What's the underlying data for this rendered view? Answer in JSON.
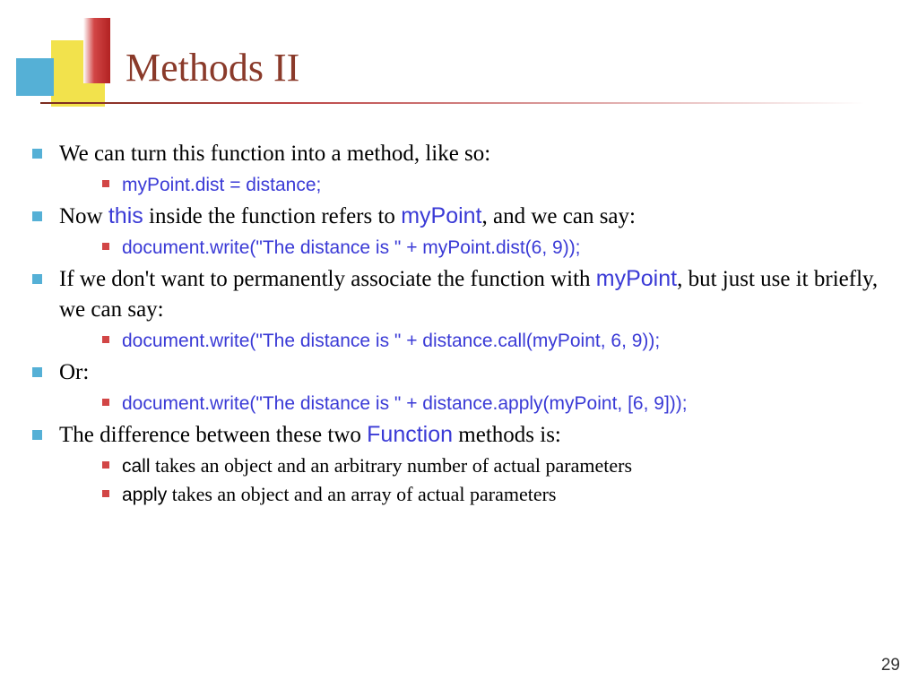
{
  "title": "Methods II",
  "page_number": "29",
  "bullets": {
    "b1_pre": "We can turn this function into a method, like so:",
    "b1_code": "myPoint.dist = distance;",
    "b2_pre": "Now ",
    "b2_this": "this",
    "b2_mid": " inside the function refers to ",
    "b2_mp": "myPoint",
    "b2_post": ", and we can say:",
    "b2_code": "document.write(\"The distance is \" + myPoint.dist(6, 9));",
    "b3_pre": "If we don't want to permanently associate the function with ",
    "b3_mp": "myPoint",
    "b3_post": ", but just use it briefly, we can say:",
    "b3_code": "document.write(\"The distance is \" + distance.call(myPoint, 6, 9));",
    "b4_pre": "Or:",
    "b4_code": "document.write(\"The distance is \" + distance.apply(myPoint, [6, 9]));",
    "b5_pre": "The difference between these two ",
    "b5_fn": "Function",
    "b5_post": " methods is:",
    "b5_sub1_kw": "call",
    "b5_sub1_txt": " takes an object and an arbitrary number of actual parameters",
    "b5_sub2_kw": "apply",
    "b5_sub2_txt": " takes an object and an array of actual parameters"
  }
}
